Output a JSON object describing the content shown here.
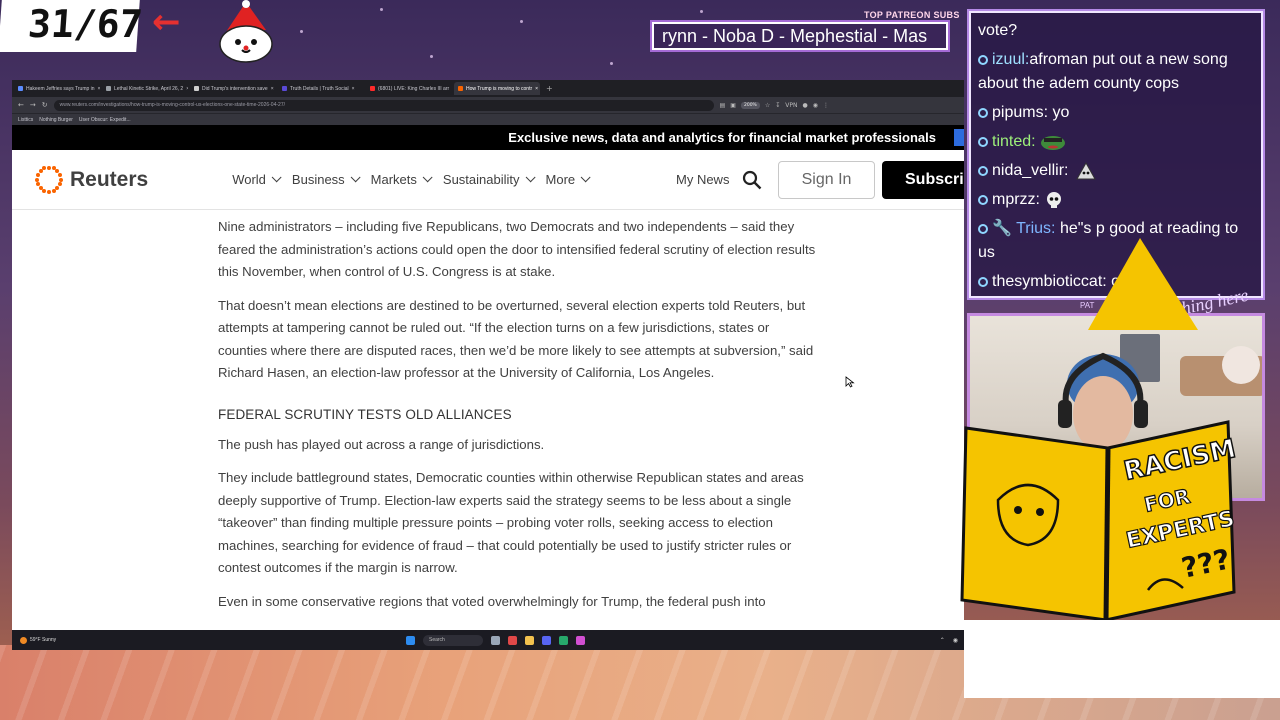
{
  "overlay": {
    "counter": "31/67",
    "patreon_label": "TOP PATREON SUBS",
    "patreon_ticker": "rynn -  Noba D - Mephestial - Mas",
    "webcam_label": "PAT",
    "cam_sign": "thing here"
  },
  "browser": {
    "tabs": [
      {
        "label": "Hakeem Jeffries says Trump in",
        "color": "#5b8cff",
        "active": false
      },
      {
        "label": "Lethal Kinetic Strike, April 26, 2",
        "color": "#9aa0a6",
        "active": false
      },
      {
        "label": "Did Trump's intervention save",
        "color": "#cfcfcf",
        "active": false
      },
      {
        "label": "Truth Details | Truth Social",
        "color": "#5a4ad6",
        "active": false
      },
      {
        "label": "(6801) LIVE: King Charles III arr",
        "color": "#ff2a2a",
        "active": false
      },
      {
        "label": "How Trump is moving to contr",
        "color": "#fa6400",
        "active": true
      }
    ],
    "url": "www.reuters.com/investigations/how-trump-is-moving-control-us-elections-one-state-time-2026-04-27/",
    "zoom": "200%",
    "vpn": "VPN",
    "bookmarks": [
      "Listtics",
      "Nothing Burger",
      "User Obscur: Expedit..."
    ]
  },
  "site": {
    "banner": "Exclusive news, data and analytics for financial market professionals",
    "banner_cta": "L",
    "logo": "Reuters",
    "nav": [
      "World",
      "Business",
      "Markets",
      "Sustainability",
      "More"
    ],
    "my_news": "My News",
    "sign_in": "Sign In",
    "subscribe": "Subscribe"
  },
  "article": {
    "p1": "Nine administrators – including five Republicans, two Democrats and two independents – said they feared the administration’s actions could open the door to intensified federal scrutiny of election results this November, when control of U.S. Congress is at stake.",
    "p2": "That doesn’t mean elections are destined to be overturned, several election experts told Reuters, but attempts at tampering cannot be ruled out. “If the election turns on a few jurisdictions, states or counties where there are disputed races, then we’d be more likely to see attempts at subversion,” said Richard Hasen, an election-law professor at the University of California, Los Angeles.",
    "heading": "FEDERAL SCRUTINY TESTS OLD ALLIANCES",
    "p3": "The push has played out across a range of jurisdictions.",
    "p4": "They include battleground states, Democratic counties within otherwise Republican states and areas deeply supportive of Trump. Election-law experts said the strategy seems to be less about a single “takeover” than finding multiple pressure points – probing voter rolls, seeking access to election machines, searching for evidence of fraud – that could potentially be used to justify stricter rules or contest outcomes if the margin is narrow.",
    "p5": "Even in some conservative regions that voted overwhelmingly for Trump, the federal push into"
  },
  "taskbar": {
    "weather": "59°F Sunny",
    "search": "Search"
  },
  "chat": {
    "messages": [
      {
        "user": "",
        "text": "vote?"
      },
      {
        "user": "izuul:",
        "text": "afroman put out a new song about the adem county cops"
      },
      {
        "user": "pipums:",
        "text": "yo"
      },
      {
        "user": "tinted:",
        "text": ""
      },
      {
        "user": "nida_vellir:",
        "text": ""
      },
      {
        "user": "mprzz:",
        "text": ""
      },
      {
        "user": "Trius:",
        "text": "he\"s p good at reading to us"
      },
      {
        "user": "thesymbioticcat:",
        "text": "oh"
      }
    ]
  },
  "book": {
    "line1": "RACISM",
    "line2": "FOR",
    "line3": "EXPERTS",
    "marks": "???"
  }
}
